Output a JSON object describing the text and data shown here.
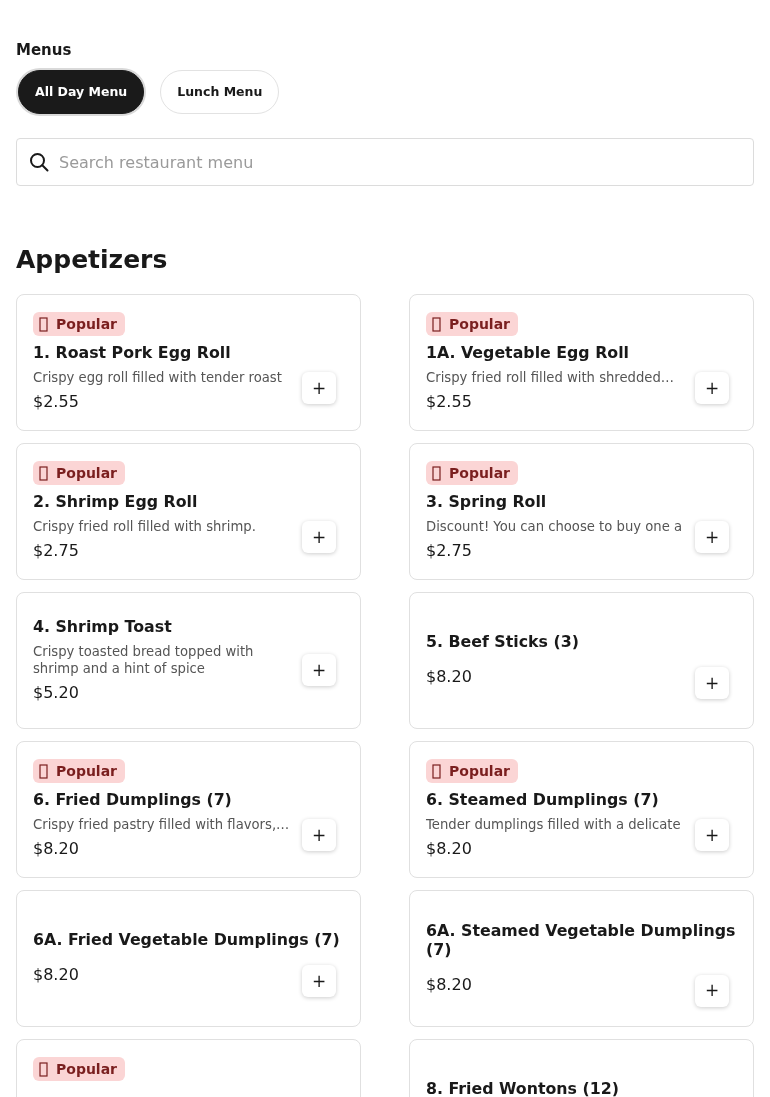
{
  "menus_heading": "Menus",
  "menu_tabs": [
    {
      "label": "All Day Menu",
      "selected": true
    },
    {
      "label": "Lunch Menu",
      "selected": false
    }
  ],
  "search": {
    "placeholder": "Search restaurant menu"
  },
  "section": {
    "title": "Appetizers",
    "items": [
      {
        "badge": "Popular",
        "name": "1. Roast Pork Egg Roll",
        "description": "Crispy egg roll filled with tender roast",
        "price": "$2.55",
        "add": "+"
      },
      {
        "badge": "Popular",
        "name": "1A. Vegetable Egg Roll",
        "description": "Crispy fried roll filled with shredded…",
        "price": "$2.55",
        "add": "+"
      },
      {
        "badge": "Popular",
        "name": "2. Shrimp Egg Roll",
        "description": "Crispy fried roll filled with shrimp.",
        "price": "$2.75",
        "add": "+"
      },
      {
        "badge": "Popular",
        "name": "3. Spring Roll",
        "description": "Discount! You can choose to buy one a",
        "price": "$2.75",
        "add": "+"
      },
      {
        "name": "4. Shrimp Toast",
        "description": "Crispy toasted bread topped with shrimp and a hint of spice",
        "price": "$5.20",
        "add": "+"
      },
      {
        "name": "5. Beef Sticks (3)",
        "price": "$8.20",
        "add": "+"
      },
      {
        "badge": "Popular",
        "name": "6. Fried Dumplings (7)",
        "description": "Crispy fried pastry filled with flavors,…",
        "price": "$8.20",
        "add": "+"
      },
      {
        "badge": "Popular",
        "name": "6. Steamed Dumplings (7)",
        "description": "Tender dumplings filled with a delicate",
        "price": "$8.20",
        "add": "+"
      },
      {
        "name": "6A. Fried Vegetable Dumplings (7)",
        "price": "$8.20",
        "add": "+"
      },
      {
        "name": "6A. Steamed Vegetable Dumplings (7)",
        "price": "$8.20",
        "add": "+"
      },
      {
        "badge": "Popular"
      },
      {
        "name": "8. Fried Wontons (12)"
      }
    ]
  }
}
